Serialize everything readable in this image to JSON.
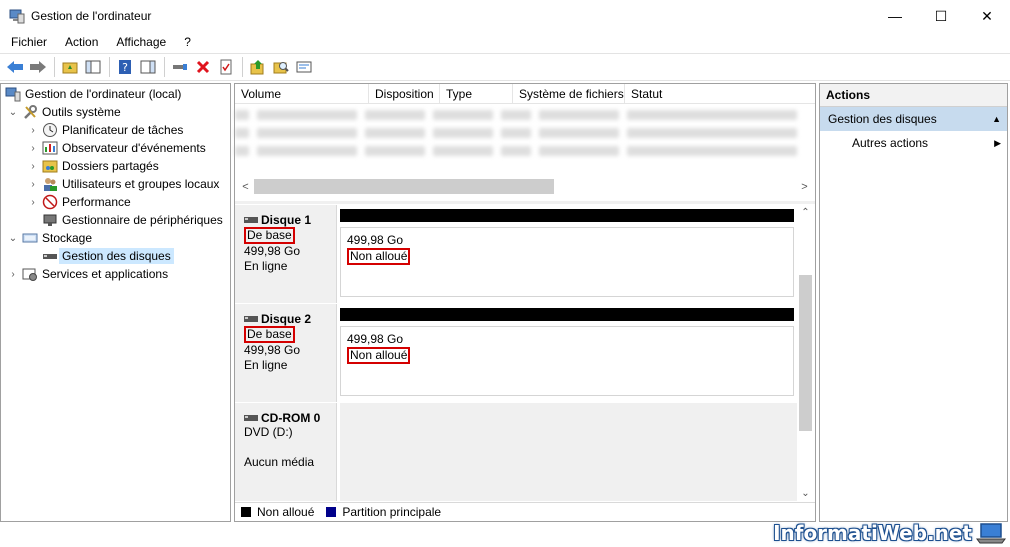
{
  "window": {
    "title": "Gestion de l'ordinateur",
    "controls": [
      "—",
      "☐",
      "✕"
    ]
  },
  "menu": [
    "Fichier",
    "Action",
    "Affichage",
    "?"
  ],
  "tree": [
    {
      "label": "Gestion de l'ordinateur (local)",
      "level": 0,
      "expander": ""
    },
    {
      "label": "Outils système",
      "level": 1,
      "expander": "⌄"
    },
    {
      "label": "Planificateur de tâches",
      "level": 2,
      "expander": "›"
    },
    {
      "label": "Observateur d'événements",
      "level": 2,
      "expander": "›"
    },
    {
      "label": "Dossiers partagés",
      "level": 2,
      "expander": "›"
    },
    {
      "label": "Utilisateurs et groupes locaux",
      "level": 2,
      "expander": "›"
    },
    {
      "label": "Performance",
      "level": 2,
      "expander": "›"
    },
    {
      "label": "Gestionnaire de périphériques",
      "level": 2,
      "expander": ""
    },
    {
      "label": "Stockage",
      "level": 1,
      "expander": "⌄"
    },
    {
      "label": "Gestion des disques",
      "level": 2,
      "expander": "",
      "selected": true
    },
    {
      "label": "Services et applications",
      "level": 1,
      "expander": "›"
    }
  ],
  "volume_headers": [
    "Volume",
    "Disposition",
    "Type",
    "Système de fichiers",
    "Statut"
  ],
  "disks": [
    {
      "name": "Disque 1",
      "type": "De base",
      "size": "499,98 Go",
      "state": "En ligne",
      "partition_size": "499,98 Go",
      "partition_status": "Non alloué"
    },
    {
      "name": "Disque 2",
      "type": "De base",
      "size": "499,98 Go",
      "state": "En ligne",
      "partition_size": "499,98 Go",
      "partition_status": "Non alloué"
    }
  ],
  "cdrom": {
    "name": "CD-ROM 0",
    "drive": "DVD (D:)",
    "media": "Aucun média"
  },
  "legend": [
    {
      "label": "Non alloué",
      "color": "#000000"
    },
    {
      "label": "Partition principale",
      "color": "#00008b"
    }
  ],
  "actions": {
    "header": "Actions",
    "group": "Gestion des disques",
    "item": "Autres actions"
  },
  "watermark": "InformatiWeb.net"
}
